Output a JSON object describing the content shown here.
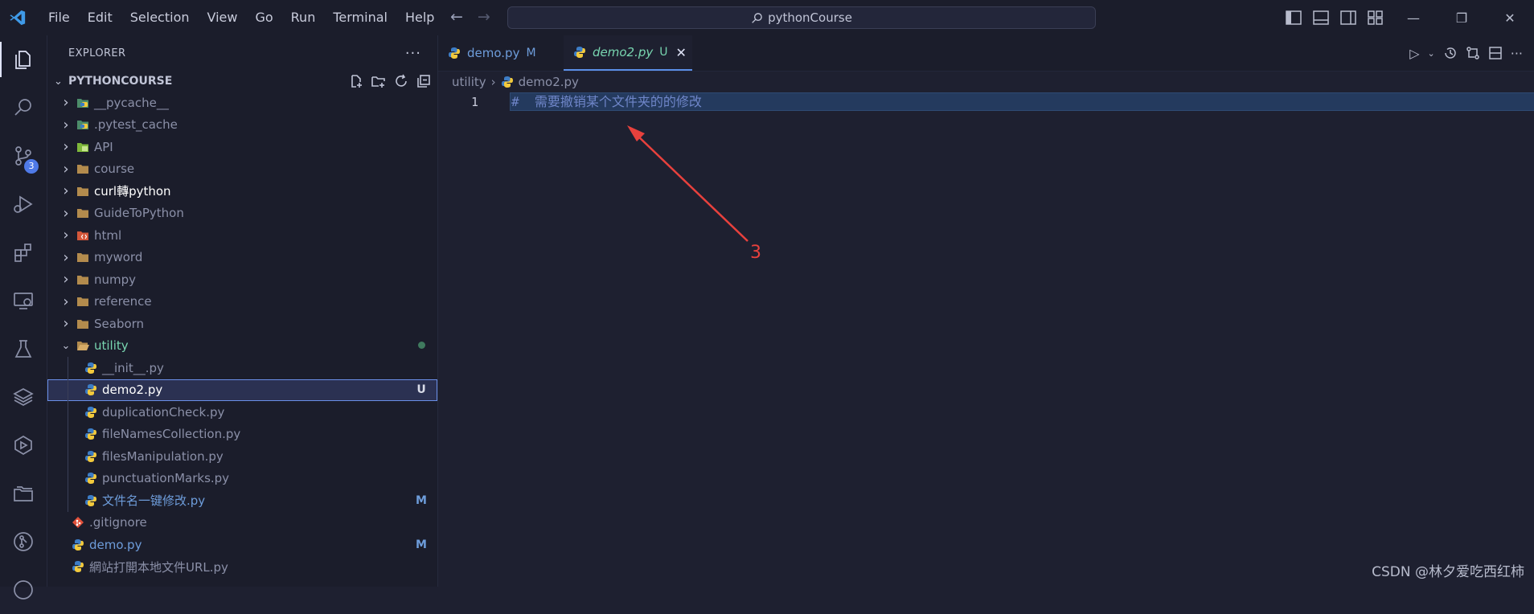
{
  "titlebar": {
    "menu": [
      "File",
      "Edit",
      "Selection",
      "View",
      "Go",
      "Run",
      "Terminal",
      "Help"
    ],
    "command_center": "pythonCourse"
  },
  "activity": {
    "scm_badge": "3"
  },
  "sidebar": {
    "title": "EXPLORER",
    "section": "PYTHONCOURSE",
    "tree": [
      {
        "label": "__pycache__",
        "type": "folder",
        "icon": "python-folder-icon",
        "expanded": false,
        "color": "#8b90a8"
      },
      {
        "label": ".pytest_cache",
        "type": "folder",
        "icon": "python-folder-icon",
        "expanded": false,
        "color": "#8b90a8"
      },
      {
        "label": "API",
        "type": "folder",
        "icon": "api-folder-icon",
        "expanded": false,
        "color": "#8b90a8"
      },
      {
        "label": "course",
        "type": "folder",
        "icon": "folder-icon",
        "expanded": false,
        "color": "#8b90a8"
      },
      {
        "label": "curl轉python",
        "type": "folder",
        "icon": "folder-icon",
        "expanded": false,
        "color": "#ffffff"
      },
      {
        "label": "GuideToPython",
        "type": "folder",
        "icon": "folder-icon",
        "expanded": false,
        "color": "#8b90a8"
      },
      {
        "label": "html",
        "type": "folder",
        "icon": "html-folder-icon",
        "expanded": false,
        "color": "#8b90a8"
      },
      {
        "label": "myword",
        "type": "folder",
        "icon": "folder-icon",
        "expanded": false,
        "color": "#8b90a8"
      },
      {
        "label": "numpy",
        "type": "folder",
        "icon": "folder-icon",
        "expanded": false,
        "color": "#8b90a8"
      },
      {
        "label": "reference",
        "type": "folder",
        "icon": "folder-icon",
        "expanded": false,
        "color": "#8b90a8"
      },
      {
        "label": "Seaborn",
        "type": "folder",
        "icon": "folder-icon",
        "expanded": false,
        "color": "#8b90a8"
      },
      {
        "label": "utility",
        "type": "folder",
        "icon": "folder-open-icon",
        "expanded": true,
        "color": "#78d5b0",
        "dot": true
      },
      {
        "label": "__init__.py",
        "type": "file",
        "icon": "python-file-icon",
        "indent": 1,
        "color": "#8b90a8"
      },
      {
        "label": "demo2.py",
        "type": "file",
        "icon": "python-file-icon",
        "indent": 1,
        "color": "#ffffff",
        "status": "U",
        "selected": true
      },
      {
        "label": "duplicationCheck.py",
        "type": "file",
        "icon": "python-file-icon",
        "indent": 1,
        "color": "#8b90a8"
      },
      {
        "label": "fileNamesCollection.py",
        "type": "file",
        "icon": "python-file-icon",
        "indent": 1,
        "color": "#8b90a8"
      },
      {
        "label": "filesManipulation.py",
        "type": "file",
        "icon": "python-file-icon",
        "indent": 1,
        "color": "#8b90a8"
      },
      {
        "label": "punctuationMarks.py",
        "type": "file",
        "icon": "python-file-icon",
        "indent": 1,
        "color": "#8b90a8"
      },
      {
        "label": "文件名一键修改.py",
        "type": "file",
        "icon": "python-file-icon",
        "indent": 1,
        "color": "#6e9ddb",
        "status": "M"
      },
      {
        "label": ".gitignore",
        "type": "file",
        "icon": "git-icon",
        "color": "#8b90a8"
      },
      {
        "label": "demo.py",
        "type": "file",
        "icon": "python-file-icon",
        "color": "#6e9ddb",
        "status": "M"
      },
      {
        "label": "網站打開本地文件URL.py",
        "type": "file",
        "icon": "python-file-icon",
        "color": "#8b90a8"
      }
    ]
  },
  "editor": {
    "tabs": [
      {
        "name": "demo.py",
        "status": "M",
        "active": false
      },
      {
        "name": "demo2.py",
        "status": "U",
        "active": true
      }
    ],
    "breadcrumb": [
      "utility",
      "demo2.py"
    ],
    "lines": [
      {
        "number": "1",
        "text": "#  需要撤销某个文件夹的的修改"
      }
    ]
  },
  "annotation": {
    "label": "3",
    "color": "#e8413d"
  },
  "watermark": "CSDN @林夕爱吃西红柿",
  "colors": {
    "accent": "#4f7ae8",
    "modified": "#6e9ddb",
    "untracked": "#78d5b0"
  }
}
